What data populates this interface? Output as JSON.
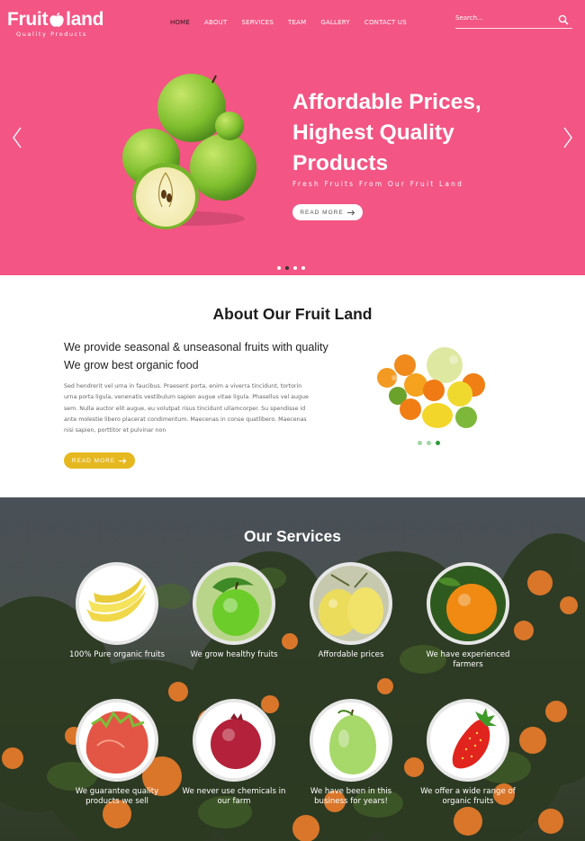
{
  "brand": {
    "name_part1": "Fruit",
    "name_part2": "land",
    "tagline": "Quality Products"
  },
  "nav": {
    "items": [
      {
        "label": "HOME",
        "active": true
      },
      {
        "label": "ABOUT",
        "active": false
      },
      {
        "label": "SERVICES",
        "active": false
      },
      {
        "label": "TEAM",
        "active": false
      },
      {
        "label": "GALLERY",
        "active": false
      },
      {
        "label": "CONTACT US",
        "active": false
      }
    ]
  },
  "search": {
    "placeholder": "Search...",
    "icon": "search-icon"
  },
  "hero": {
    "title_lines": [
      "Affordable Prices,",
      "Highest Quality",
      "Products"
    ],
    "subtitle": "Fresh Fruits From Our Fruit Land",
    "button_label": "READ MORE",
    "slide_count": 4,
    "active_slide": 2,
    "bg_color": "#f35584"
  },
  "about": {
    "title": "About Our Fruit Land",
    "lead_lines": [
      "We provide seasonal & unseasonal fruits with quality",
      "We grow best organic food"
    ],
    "body_lines": [
      "Sed hendrerit vel urna in faucibus. Praesent porta, enim a viverra tincidunt, tortorin",
      "urna porta ligula, venenatis vestibulum sapien augue vitae ligula. Phasellus vel augue",
      "sem. Nulla auctor elit augue, eu volutpat risus tincidunt ullamcorper. Su spendisse id",
      "ante molestie libero placerat condimentum. Maecenas in conse quatlibero. Maecenas",
      "nisi sapien, porttitor et pulvinar non"
    ],
    "button_label": "READ MORE",
    "button_color": "#e6b820",
    "slide_count": 3,
    "active_slide": 3
  },
  "services": {
    "title": "Our Services",
    "items": [
      {
        "label": "100% Pure organic fruits",
        "icon": "bananas"
      },
      {
        "label": "We grow healthy fruits",
        "icon": "green-apple"
      },
      {
        "label": "Affordable prices",
        "icon": "lemons"
      },
      {
        "label": "We have experienced farmers",
        "icon": "orange"
      },
      {
        "label": "We guarantee quality products we sell",
        "icon": "dragon-fruit"
      },
      {
        "label": "We never use chemicals in our farm",
        "icon": "pomegranate"
      },
      {
        "label": "We have been in this business for years!",
        "icon": "guava"
      },
      {
        "label": "We offer a wide range of organic fruits",
        "icon": "strawberry"
      }
    ]
  }
}
